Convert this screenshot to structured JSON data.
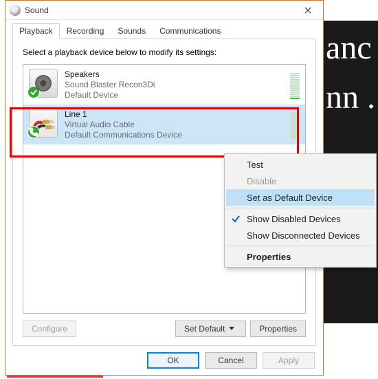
{
  "bgtext": "anc\nnn\n.",
  "dialog": {
    "title": "Sound",
    "tabs": [
      "Playback",
      "Recording",
      "Sounds",
      "Communications"
    ],
    "active_tab": 0,
    "instruction": "Select a playback device below to modify its settings:",
    "devices": [
      {
        "name": "Speakers",
        "driver": "Sound Blaster Recon3Di",
        "status": "Default Device",
        "icon": "speaker",
        "badge": "check",
        "selected": false
      },
      {
        "name": "Line 1",
        "driver": "Virtual Audio Cable",
        "status": "Default Communications Device",
        "icon": "cable",
        "badge": "phone",
        "selected": true
      }
    ],
    "buttons": {
      "configure": "Configure",
      "setdefault": "Set Default",
      "properties": "Properties",
      "ok": "OK",
      "cancel": "Cancel",
      "apply": "Apply"
    }
  },
  "context_menu": {
    "items": [
      {
        "label": "Test",
        "state": "normal"
      },
      {
        "label": "Disable",
        "state": "disabled"
      },
      {
        "label": "Set as Default Device",
        "state": "hover"
      },
      {
        "sep": true
      },
      {
        "label": "Show Disabled Devices",
        "checked": true
      },
      {
        "label": "Show Disconnected Devices"
      },
      {
        "sep": true
      },
      {
        "label": "Properties",
        "bold": true
      }
    ]
  }
}
